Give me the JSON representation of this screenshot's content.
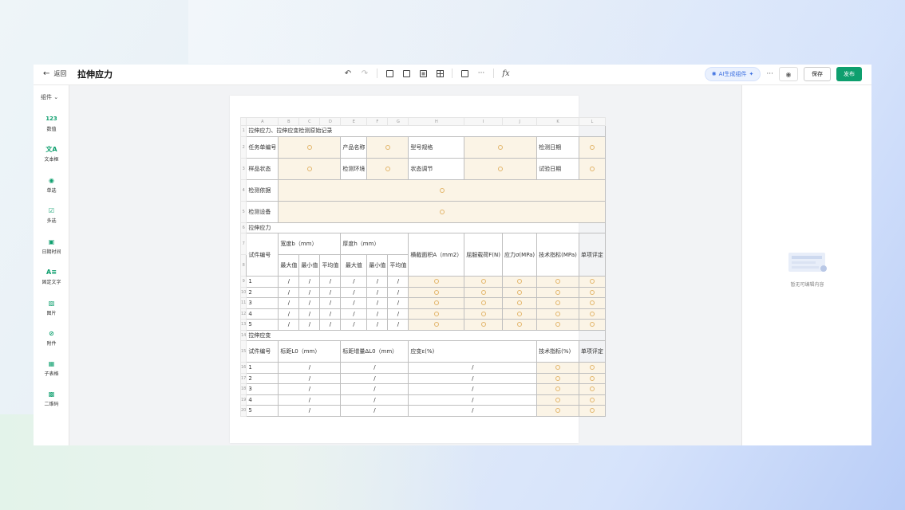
{
  "header": {
    "back_label": "返回",
    "title": "拉伸应力",
    "ai_label": "AI生成组件",
    "save_label": "保存",
    "publish_label": "发布"
  },
  "sidebar": {
    "title": "组件",
    "items": [
      {
        "label": "数值",
        "icon": "number-icon"
      },
      {
        "label": "文本框",
        "icon": "text-icon"
      },
      {
        "label": "单选",
        "icon": "radio-icon"
      },
      {
        "label": "多选",
        "icon": "checkbox-icon"
      },
      {
        "label": "日期时间",
        "icon": "calendar-icon"
      },
      {
        "label": "固定文字",
        "icon": "fixed-text-icon"
      },
      {
        "label": "图片",
        "icon": "image-icon"
      },
      {
        "label": "附件",
        "icon": "attachment-icon"
      },
      {
        "label": "子表格",
        "icon": "subtable-icon"
      },
      {
        "label": "二维码",
        "icon": "qrcode-icon"
      }
    ]
  },
  "right_panel": {
    "empty_text": "暂无可编辑内容"
  },
  "sheet": {
    "columns": [
      "A",
      "B",
      "C",
      "D",
      "E",
      "F",
      "G",
      "H",
      "I",
      "J",
      "K",
      "L"
    ],
    "title": "拉伸应力、拉伸应变检测原始记录",
    "r2": [
      "任务单编号",
      "产品名称",
      "型号规格",
      "检测日期"
    ],
    "r3": [
      "样品状态",
      "检测环境",
      "状态调节",
      "试验日期"
    ],
    "r4": "检测依据",
    "r5": "检测设备",
    "section1": "拉伸应力",
    "h1": {
      "sample_no": "试件编号",
      "width": "宽度b（mm）",
      "thickness": "厚度h（mm）",
      "area": "横截面积A（mm2）",
      "yield": "屈服载荷F(N)",
      "stress": "应力σ(MPa)",
      "tech": "技术指标(MPa)",
      "judge": "单项评定"
    },
    "sub": [
      "最大值",
      "最小值",
      "平均值",
      "最大值",
      "最小值",
      "平均值"
    ],
    "rows1": [
      "1",
      "2",
      "3",
      "4",
      "5"
    ],
    "slash": "/",
    "section2": "拉伸应变",
    "h2": {
      "sample_no": "试件编号",
      "l0": "标距L0（mm）",
      "dl0": "标距增量ΔL0（mm）",
      "strain": "应变ε(%)",
      "tech": "技术指标(%)",
      "judge": "单项评定"
    },
    "rows2": [
      "1",
      "2",
      "3",
      "4",
      "5"
    ],
    "row_numbers": [
      "1",
      "2",
      "3",
      "4",
      "5",
      "6",
      "7",
      "8",
      "9",
      "10",
      "11",
      "12",
      "13",
      "14",
      "15",
      "16",
      "17",
      "18",
      "19",
      "20"
    ]
  }
}
